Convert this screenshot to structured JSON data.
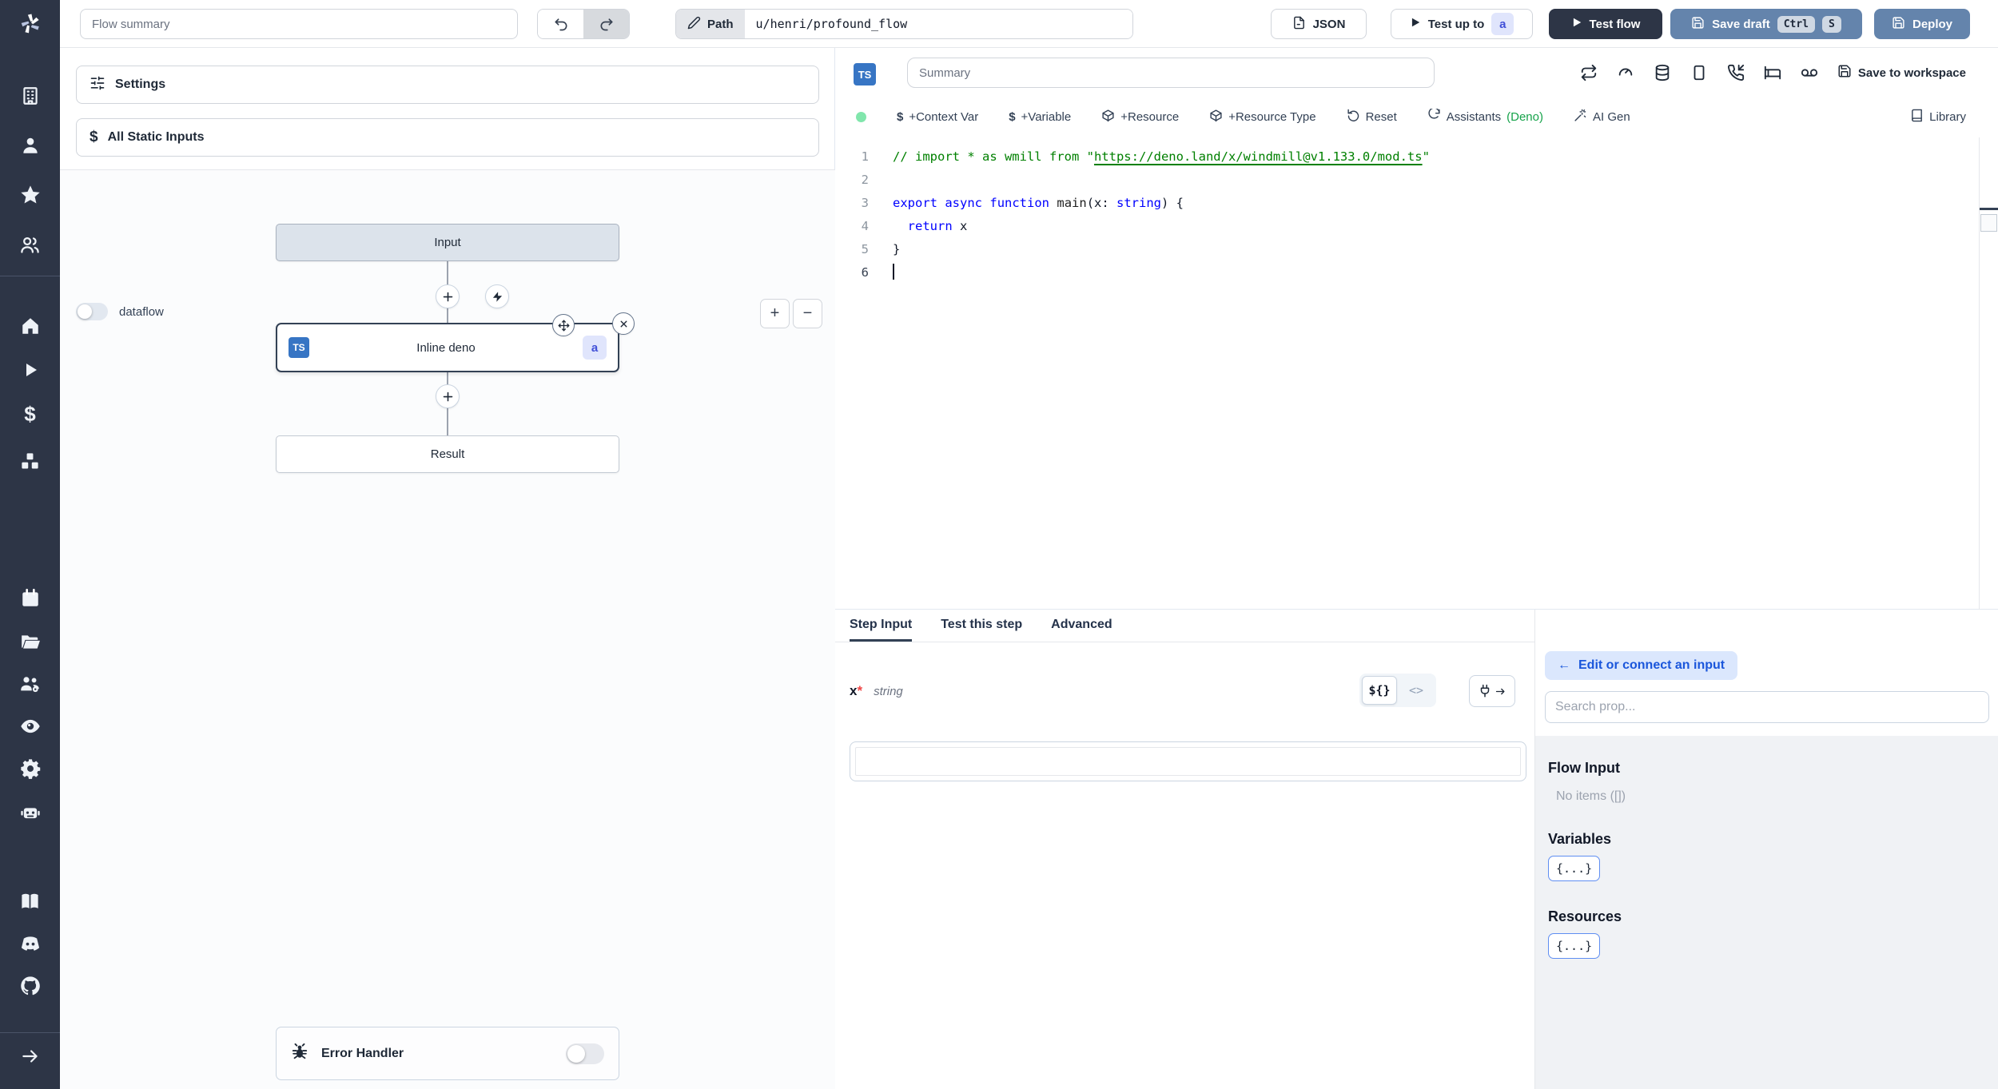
{
  "topbar": {
    "flow_summary_placeholder": "Flow summary",
    "path_label": "Path",
    "path_value": "u/henri/profound_flow",
    "json_label": "JSON",
    "test_up_to_label": "Test up to",
    "test_up_to_badge": "a",
    "test_flow_label": "Test flow",
    "save_draft_label": "Save draft",
    "save_draft_kbd": [
      "Ctrl",
      "S"
    ],
    "deploy_label": "Deploy"
  },
  "sidebar": {
    "icons": [
      "workspace-building",
      "user",
      "favorites-star",
      "groups",
      "home",
      "runs-play",
      "variables-dollar",
      "resources-cubes",
      "schedules-calendar",
      "folders",
      "workers-groups-gear",
      "audit-eye",
      "settings-gear",
      "ai-robot",
      "docs-book",
      "discord",
      "github",
      "collapse-arrow-right"
    ]
  },
  "flow_panel": {
    "settings_label": "Settings",
    "static_inputs_label": "All Static Inputs",
    "static_inputs_icon": "$",
    "dataflow_label": "dataflow",
    "zoom_in": "+",
    "zoom_out": "−",
    "nodes": {
      "input_label": "Input",
      "step_badge": "TS",
      "step_label": "Inline deno",
      "step_suffix": "a",
      "result_label": "Result"
    },
    "error_handler_label": "Error Handler"
  },
  "editor": {
    "language_badge": "TS",
    "summary_placeholder": "Summary",
    "save_to_workspace_label": "Save to workspace",
    "toolbar_icons": [
      "repeat",
      "gauge",
      "database",
      "square",
      "phone-incoming",
      "bed",
      "voicemail"
    ],
    "toolbar2": {
      "dollar": "$",
      "context_var": "+Context Var",
      "variable": "+Variable",
      "resource": "+Resource",
      "resource_type": "+Resource Type",
      "reset": "Reset",
      "assistants": "Assistants",
      "assistants_lang": "(Deno)",
      "ai_gen": "AI Gen",
      "library": "Library"
    },
    "code": {
      "cursor_line": 6,
      "lines": [
        {
          "tokens": [
            {
              "t": "// import * as wmill from \"",
              "c": "cm"
            },
            {
              "t": "https://deno.land/x/windmill@v1.133.0/mod.ts",
              "c": "cm u"
            },
            {
              "t": "\"",
              "c": "cm"
            }
          ]
        },
        {
          "tokens": []
        },
        {
          "tokens": [
            {
              "t": "export",
              "c": "kw"
            },
            {
              "t": " ",
              "c": "pl"
            },
            {
              "t": "async",
              "c": "kw"
            },
            {
              "t": " ",
              "c": "pl"
            },
            {
              "t": "function",
              "c": "kw"
            },
            {
              "t": " ",
              "c": "pl"
            },
            {
              "t": "main",
              "c": "fn"
            },
            {
              "t": "(x: ",
              "c": "pl"
            },
            {
              "t": "string",
              "c": "kw"
            },
            {
              "t": ") {",
              "c": "pl"
            }
          ]
        },
        {
          "tokens": [
            {
              "t": "  ",
              "c": "pl"
            },
            {
              "t": "return",
              "c": "kw"
            },
            {
              "t": " x",
              "c": "pl"
            }
          ]
        },
        {
          "tokens": [
            {
              "t": "}",
              "c": "pl"
            }
          ]
        },
        {
          "tokens": []
        }
      ]
    }
  },
  "bottom": {
    "tabs": [
      "Step Input",
      "Test this step",
      "Advanced"
    ],
    "field_name": "x",
    "required_mark": "*",
    "field_type": "string",
    "toggle_expr": "${}",
    "toggle_code": "<>"
  },
  "prop_panel": {
    "back_arrow": "←",
    "edit_connect_label": "Edit or connect an input",
    "search_placeholder": "Search prop...",
    "flow_input_title": "Flow Input",
    "flow_input_empty": "No items ([])",
    "variables_title": "Variables",
    "variables_chip": "{...}",
    "resources_title": "Resources",
    "resources_chip": "{...}"
  },
  "colors": {
    "sidebar_bg": "#2d3546",
    "accent_blue": "#6484ac",
    "dark_navy": "#2d3546",
    "badge_bg": "#e0e5fc",
    "badge_text": "#4150d8",
    "ts_badge_blue": "#3775c4",
    "deno_green": "#16a34a",
    "link_blue": "#1a56db",
    "green_dot": "#81e6ac",
    "comment_green": "#008000",
    "keyword_blue": "#0000ff"
  }
}
